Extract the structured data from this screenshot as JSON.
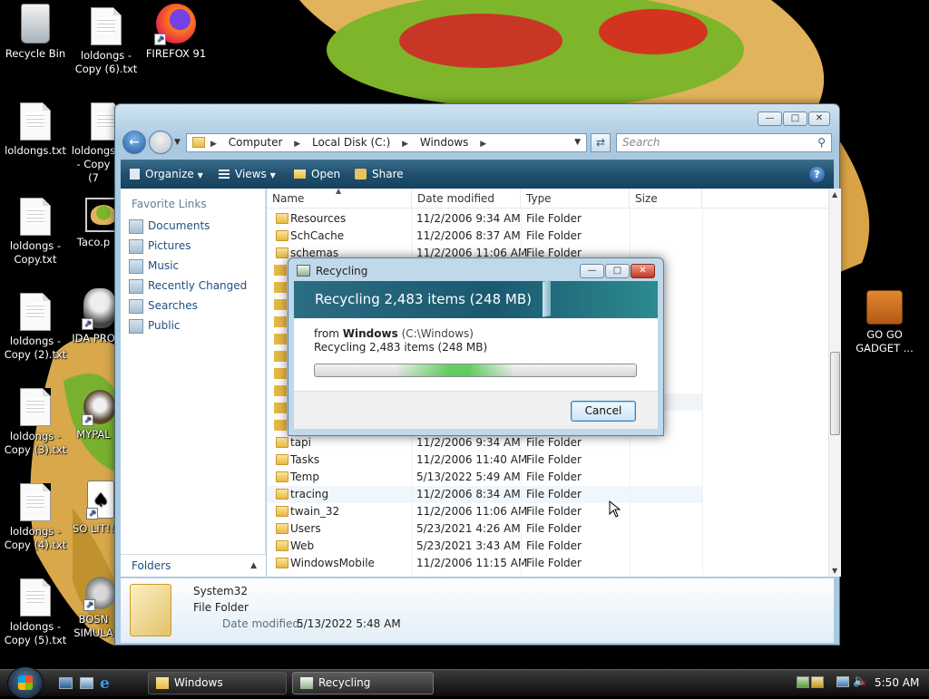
{
  "desktop": {
    "icons": [
      {
        "label": "Recycle Bin",
        "icon": "recycle-bin-icon"
      },
      {
        "label": "loldongs - Copy (6).txt",
        "icon": "text-file-icon"
      },
      {
        "label": "FIREFOX 91",
        "icon": "firefox-icon"
      },
      {
        "label": "loldongs.txt",
        "icon": "text-file-icon"
      },
      {
        "label": "loldongs - Copy (7",
        "icon": "text-file-icon"
      },
      {
        "label": "loldongs - Copy.txt",
        "icon": "text-file-icon"
      },
      {
        "label": "Taco.p",
        "icon": "image-file-icon"
      },
      {
        "label": "loldongs - Copy (2).txt",
        "icon": "text-file-icon"
      },
      {
        "label": "IDA PRO",
        "icon": "ida-pro-icon"
      },
      {
        "label": "loldongs - Copy (3).txt",
        "icon": "text-file-icon"
      },
      {
        "label": "MYPAL",
        "icon": "mypal-icon"
      },
      {
        "label": "loldongs - Copy (4).txt",
        "icon": "text-file-icon"
      },
      {
        "label": "SO LIT!!",
        "icon": "cards-icon"
      },
      {
        "label": "loldongs - Copy (5).txt",
        "icon": "text-file-icon"
      },
      {
        "label": "BOSN SIMULA",
        "icon": "bosn-simulator-icon"
      },
      {
        "label": "GO GO GADGET ...",
        "icon": "briefcase-icon"
      }
    ]
  },
  "explorer": {
    "address": [
      "Computer",
      "Local Disk (C:)",
      "Windows"
    ],
    "search_placeholder": "Search",
    "toolbar": {
      "organize": "Organize",
      "views": "Views",
      "open": "Open",
      "share": "Share"
    },
    "nav": {
      "header": "Favorite Links",
      "items": [
        "Documents",
        "Pictures",
        "Music",
        "Recently Changed",
        "Searches",
        "Public"
      ],
      "folders": "Folders"
    },
    "columns": {
      "name": "Name",
      "date": "Date modified",
      "type": "Type",
      "size": "Size"
    },
    "rows_top": [
      {
        "name": "Resources",
        "date": "11/2/2006 9:34 AM",
        "type": "File Folder"
      },
      {
        "name": "SchCache",
        "date": "11/2/2006 8:37 AM",
        "type": "File Folder"
      },
      {
        "name": "schemas",
        "date": "11/2/2006 11:06 AM",
        "type": "File Folder"
      }
    ],
    "rows_bottom": [
      {
        "name": "tapi",
        "date": "11/2/2006 9:34 AM",
        "type": "File Folder"
      },
      {
        "name": "Tasks",
        "date": "11/2/2006 11:40 AM",
        "type": "File Folder"
      },
      {
        "name": "Temp",
        "date": "5/13/2022 5:49 AM",
        "type": "File Folder"
      },
      {
        "name": "tracing",
        "date": "11/2/2006 8:34 AM",
        "type": "File Folder"
      },
      {
        "name": "twain_32",
        "date": "11/2/2006 11:06 AM",
        "type": "File Folder"
      },
      {
        "name": "Users",
        "date": "5/23/2021 4:26 AM",
        "type": "File Folder"
      },
      {
        "name": "Web",
        "date": "5/23/2021 3:43 AM",
        "type": "File Folder"
      },
      {
        "name": "WindowsMobile",
        "date": "11/2/2006 11:15 AM",
        "type": "File Folder"
      }
    ],
    "details": {
      "name": "System32",
      "type": "File Folder",
      "date_label": "Date modified:",
      "date_value": "5/13/2022 5:48 AM"
    }
  },
  "dialog": {
    "title": "Recycling",
    "banner": "Recycling 2,483 items (248 MB)",
    "from_prefix": "from",
    "from_name": "Windows",
    "from_path": "(C:\\Windows)",
    "status": "Recycling 2,483 items (248 MB)",
    "cancel": "Cancel"
  },
  "taskbar": {
    "buttons": [
      "Windows",
      "Recycling"
    ],
    "clock": "5:50 AM"
  }
}
